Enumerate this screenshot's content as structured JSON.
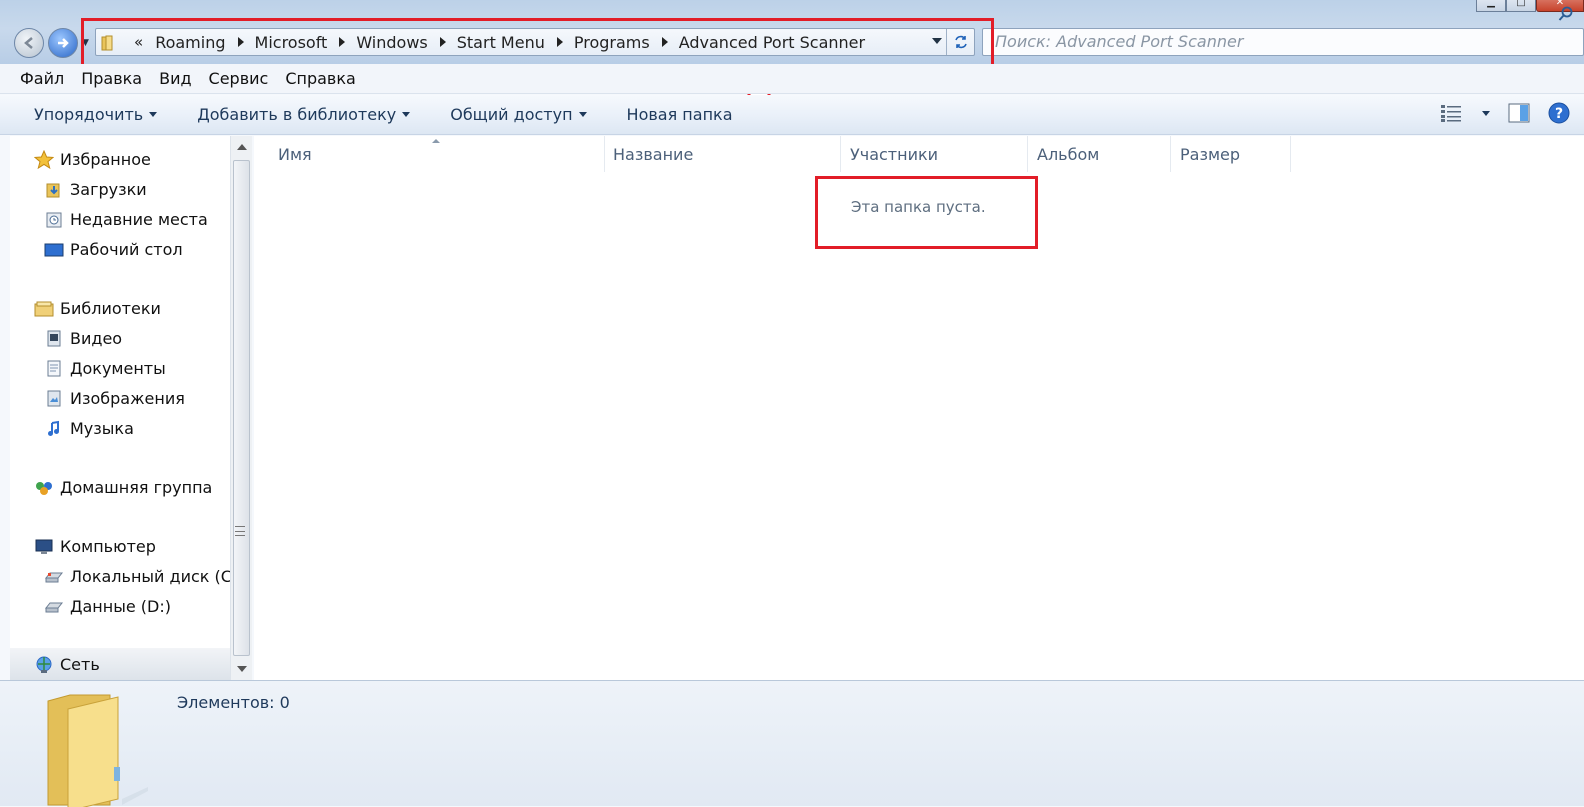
{
  "window": {
    "min_glyph": "▁",
    "max_glyph": "□",
    "close_glyph": "✕"
  },
  "address": {
    "overflow": "«",
    "crumbs": [
      "Roaming",
      "Microsoft",
      "Windows",
      "Start Menu",
      "Programs",
      "Advanced Port Scanner"
    ]
  },
  "search": {
    "placeholder": "Поиск: Advanced Port Scanner"
  },
  "menu": [
    "Файл",
    "Правка",
    "Вид",
    "Сервис",
    "Справка"
  ],
  "toolbar": {
    "organize": "Упорядочить",
    "add_to_library": "Добавить в библиотеку",
    "share": "Общий доступ",
    "new_folder": "Новая папка"
  },
  "sidebar": {
    "favorites": "Избранное",
    "downloads": "Загрузки",
    "recent": "Недавние места",
    "desktop": "Рабочий стол",
    "libraries": "Библиотеки",
    "video": "Видео",
    "documents": "Документы",
    "images": "Изображения",
    "music": "Музыка",
    "homegroup": "Домашняя группа",
    "computer": "Компьютер",
    "local_disk": "Локальный диск (C:)",
    "data_disk": "Данные (D:)",
    "network": "Сеть"
  },
  "columns": [
    "Имя",
    "Название",
    "Участники",
    "Альбом",
    "Размер"
  ],
  "content": {
    "empty_message": "Эта папка пуста."
  },
  "details": {
    "count": "Элементов: 0"
  },
  "colors": {
    "highlight": "#e21d28",
    "toolbar_text": "#1e395b"
  }
}
